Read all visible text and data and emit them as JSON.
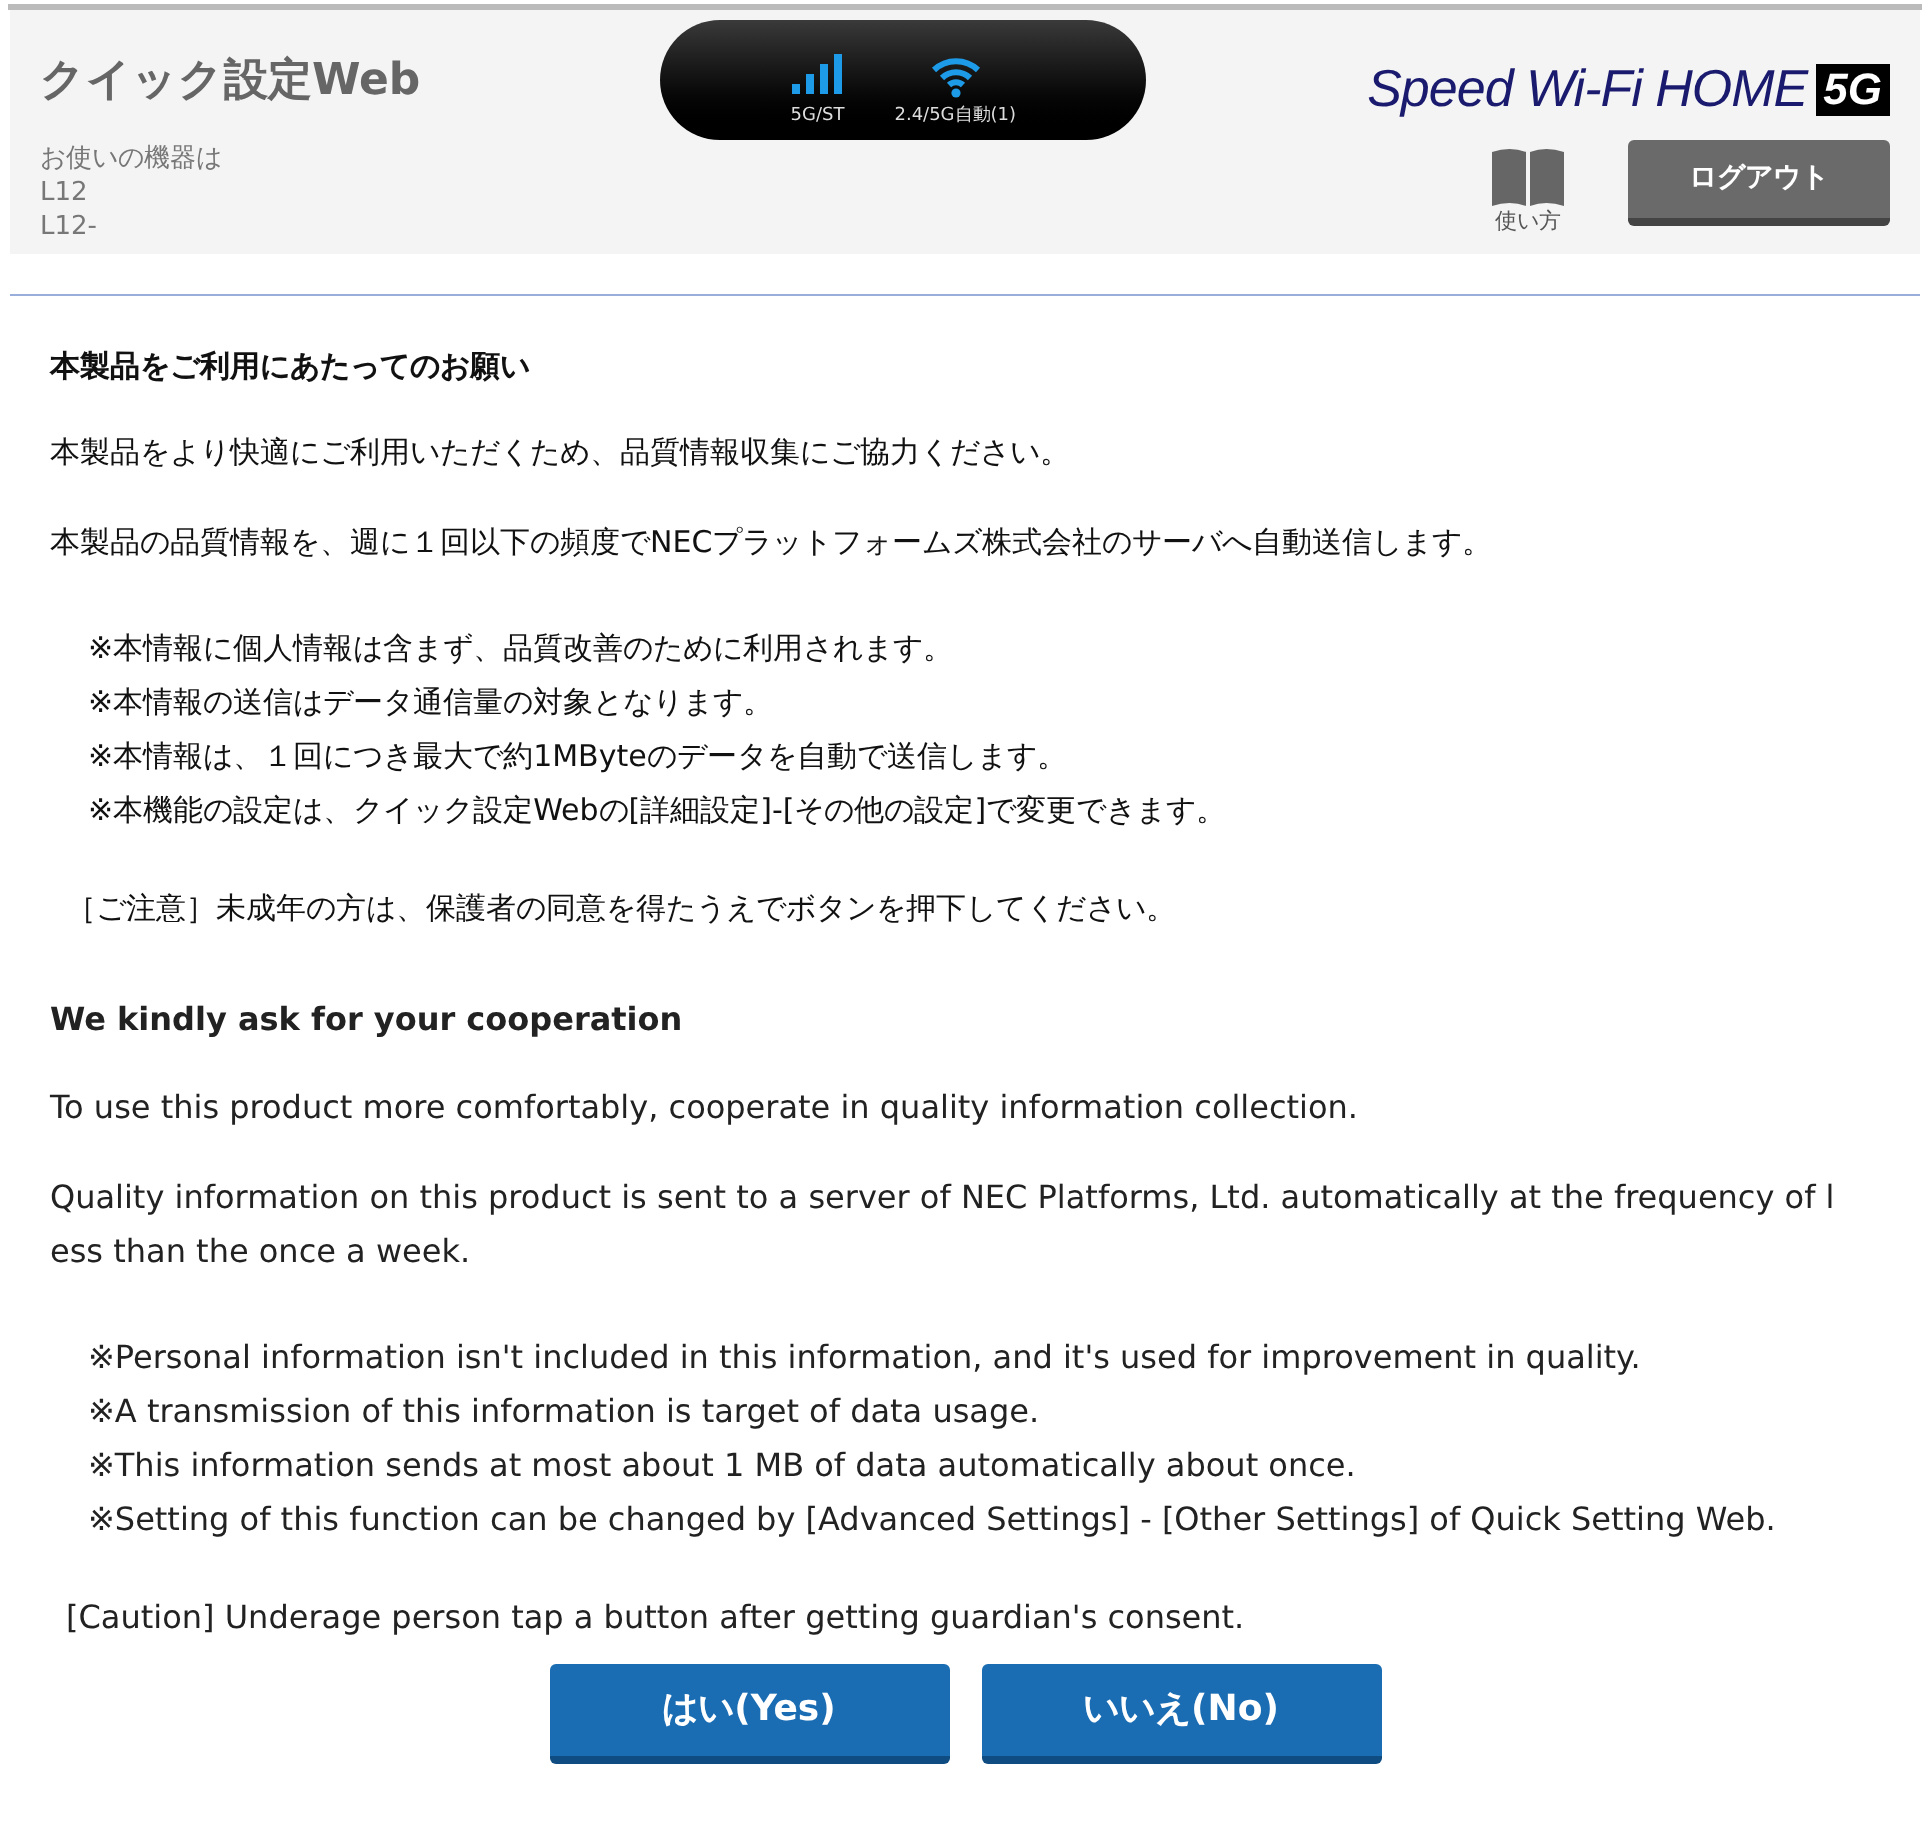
{
  "header": {
    "title": "クイック設定Web",
    "device_label": "お使いの機器は",
    "device_model": "L12",
    "device_serial": "L12-",
    "status": {
      "signal_label": "5G/ST",
      "wifi_label": "2.4/5G自動(1)"
    },
    "logo": {
      "text": "Speed Wi-Fi HOME",
      "badge": "5G"
    },
    "help": {
      "label": "使い方"
    },
    "logout": {
      "label": "ログアウト"
    }
  },
  "notice": {
    "jp": {
      "heading": "本製品をご利用にあたってのお願い",
      "paragraphs": [
        "本製品をより快適にご利用いただくため、品質情報収集にご協力ください。",
        "本製品の品質情報を、週に１回以下の頻度でNECプラットフォームズ株式会社のサーバへ自動送信します。"
      ],
      "notes": [
        "※本情報に個人情報は含まず、品質改善のために利用されます。",
        "※本情報の送信はデータ通信量の対象となります。",
        "※本情報は、１回につき最大で約1MByteのデータを自動で送信します。",
        "※本機能の設定は、クイック設定Webの[詳細設定]-[その他の設定]で変更できます。"
      ],
      "caution": "［ご注意］未成年の方は、保護者の同意を得たうえでボタンを押下してください。"
    },
    "en": {
      "heading": "We kindly ask for your cooperation",
      "paragraphs": [
        "To use this product more comfortably, cooperate in quality information collection.",
        "Quality information on this product is sent to a server of NEC Platforms, Ltd. automatically at the frequency of less than the once a week."
      ],
      "notes": [
        "※Personal information isn't included in this information, and it's used for improvement in quality.",
        "※A transmission of this information is target of data usage.",
        "※This information sends at most about 1 MB of data automatically about once.",
        "※Setting of this function can be changed by [Advanced Settings] - [Other Settings] of Quick Setting Web."
      ],
      "caution": "[Caution] Underage person tap a button after getting guardian's consent."
    }
  },
  "buttons": [
    {
      "label": "はい(Yes)"
    },
    {
      "label": "いいえ(No)"
    }
  ]
}
